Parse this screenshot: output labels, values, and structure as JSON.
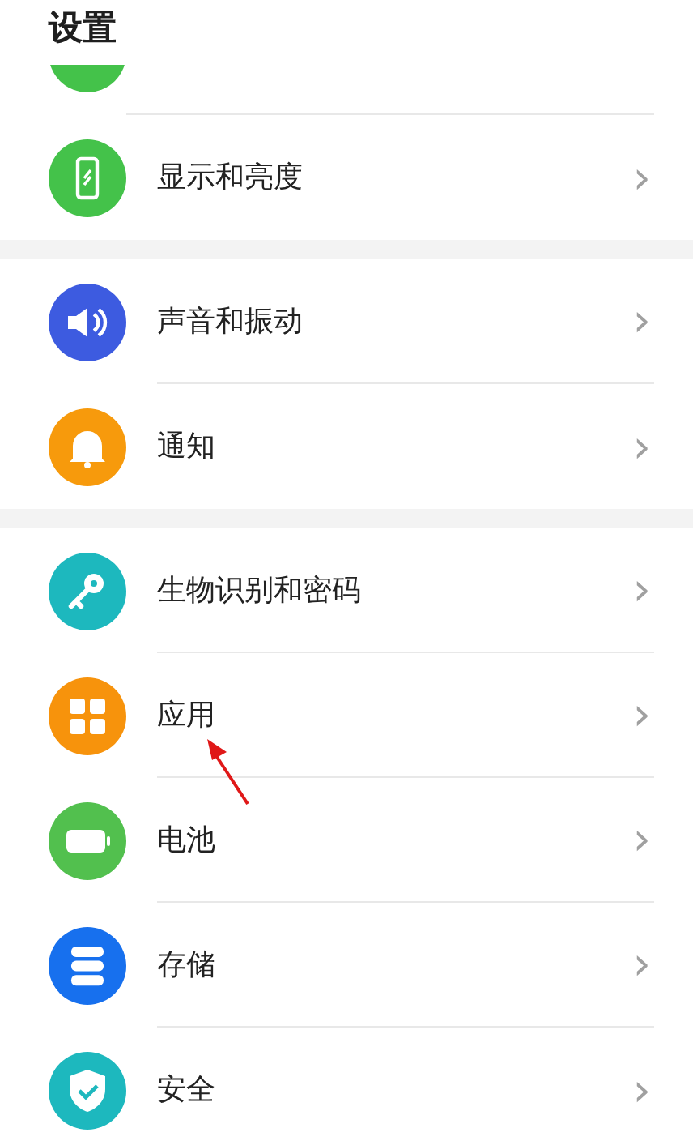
{
  "title": "设置",
  "groups": [
    {
      "items": [
        {
          "kind": "partial"
        },
        {
          "kind": "display",
          "label": "显示和亮度",
          "chevron": "›"
        }
      ]
    },
    {
      "items": [
        {
          "kind": "sound",
          "label": "声音和振动",
          "chevron": "›"
        },
        {
          "kind": "bell",
          "label": "通知",
          "chevron": "›"
        }
      ]
    },
    {
      "items": [
        {
          "kind": "key",
          "label": "生物识别和密码",
          "chevron": "›"
        },
        {
          "kind": "apps",
          "label": "应用",
          "chevron": "›"
        },
        {
          "kind": "battery",
          "label": "电池",
          "chevron": "›"
        },
        {
          "kind": "storage",
          "label": "存储",
          "chevron": "›"
        },
        {
          "kind": "shield",
          "label": "安全",
          "chevron": "›"
        }
      ]
    }
  ]
}
